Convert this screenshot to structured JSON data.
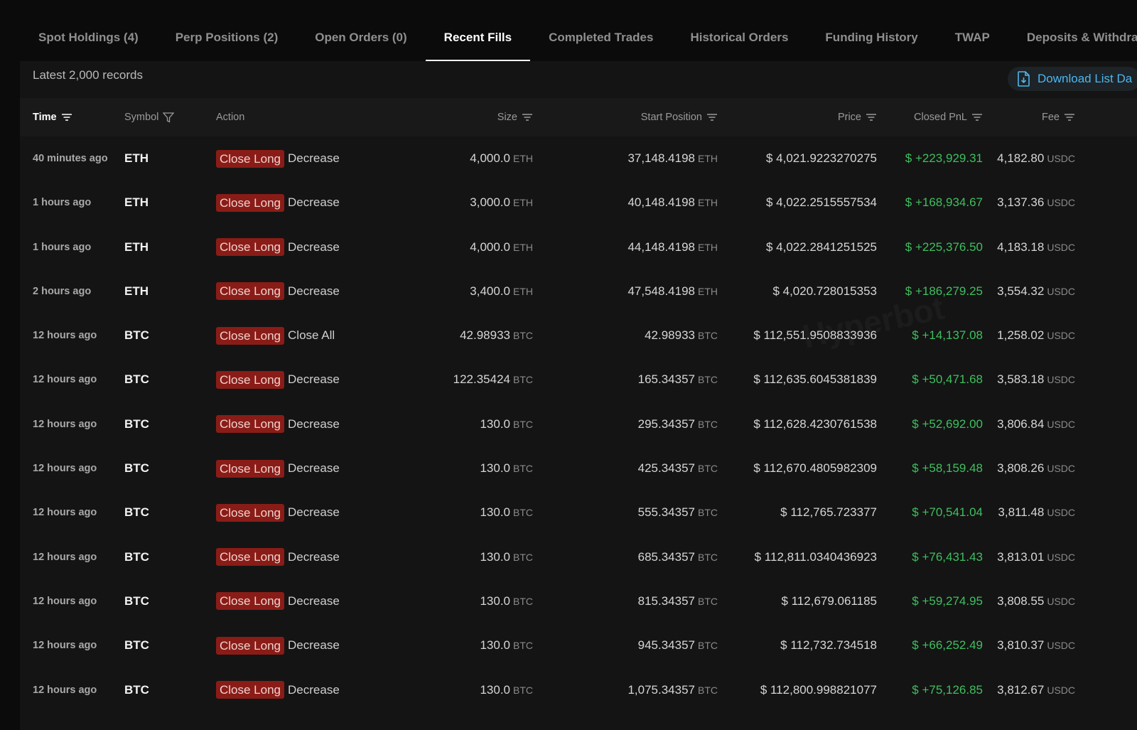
{
  "tabs": [
    {
      "label": "Spot Holdings (4)"
    },
    {
      "label": "Perp Positions (2)"
    },
    {
      "label": "Open Orders (0)"
    },
    {
      "label": "Recent Fills",
      "active": true
    },
    {
      "label": "Completed Trades"
    },
    {
      "label": "Historical Orders"
    },
    {
      "label": "Funding History"
    },
    {
      "label": "TWAP"
    },
    {
      "label": "Deposits & Withdraw"
    }
  ],
  "records_label": "Latest 2,000 records",
  "download_label": "Download List Da",
  "watermark": "Hyperbot",
  "columns": {
    "time": "Time",
    "symbol": "Symbol",
    "action": "Action",
    "size": "Size",
    "start_position": "Start Position",
    "price": "Price",
    "closed_pnl": "Closed PnL",
    "fee": "Fee"
  },
  "colors": {
    "accent": "#4fb6ef",
    "pnl_positive": "#3fbf5f",
    "badge_bg": "#8a1c17"
  },
  "rows": [
    {
      "time": "40 minutes ago",
      "symbol": "ETH",
      "badge": "Close Long",
      "action": "Decrease",
      "size": "4,000.0",
      "size_unit": "ETH",
      "start": "37,148.4198",
      "start_unit": "ETH",
      "price": "$ 4,021.9223270275",
      "pnl": "$ +223,929.31",
      "fee": "4,182.80",
      "fee_unit": "USDC"
    },
    {
      "time": "1 hours ago",
      "symbol": "ETH",
      "badge": "Close Long",
      "action": "Decrease",
      "size": "3,000.0",
      "size_unit": "ETH",
      "start": "40,148.4198",
      "start_unit": "ETH",
      "price": "$ 4,022.2515557534",
      "pnl": "$ +168,934.67",
      "fee": "3,137.36",
      "fee_unit": "USDC"
    },
    {
      "time": "1 hours ago",
      "symbol": "ETH",
      "badge": "Close Long",
      "action": "Decrease",
      "size": "4,000.0",
      "size_unit": "ETH",
      "start": "44,148.4198",
      "start_unit": "ETH",
      "price": "$ 4,022.2841251525",
      "pnl": "$ +225,376.50",
      "fee": "4,183.18",
      "fee_unit": "USDC"
    },
    {
      "time": "2 hours ago",
      "symbol": "ETH",
      "badge": "Close Long",
      "action": "Decrease",
      "size": "3,400.0",
      "size_unit": "ETH",
      "start": "47,548.4198",
      "start_unit": "ETH",
      "price": "$ 4,020.728015353",
      "pnl": "$ +186,279.25",
      "fee": "3,554.32",
      "fee_unit": "USDC"
    },
    {
      "time": "12 hours ago",
      "symbol": "BTC",
      "badge": "Close Long",
      "action": "Close All",
      "size": "42.98933",
      "size_unit": "BTC",
      "start": "42.98933",
      "start_unit": "BTC",
      "price": "$ 112,551.9508833936",
      "pnl": "$ +14,137.08",
      "fee": "1,258.02",
      "fee_unit": "USDC"
    },
    {
      "time": "12 hours ago",
      "symbol": "BTC",
      "badge": "Close Long",
      "action": "Decrease",
      "size": "122.35424",
      "size_unit": "BTC",
      "start": "165.34357",
      "start_unit": "BTC",
      "price": "$ 112,635.6045381839",
      "pnl": "$ +50,471.68",
      "fee": "3,583.18",
      "fee_unit": "USDC"
    },
    {
      "time": "12 hours ago",
      "symbol": "BTC",
      "badge": "Close Long",
      "action": "Decrease",
      "size": "130.0",
      "size_unit": "BTC",
      "start": "295.34357",
      "start_unit": "BTC",
      "price": "$ 112,628.4230761538",
      "pnl": "$ +52,692.00",
      "fee": "3,806.84",
      "fee_unit": "USDC"
    },
    {
      "time": "12 hours ago",
      "symbol": "BTC",
      "badge": "Close Long",
      "action": "Decrease",
      "size": "130.0",
      "size_unit": "BTC",
      "start": "425.34357",
      "start_unit": "BTC",
      "price": "$ 112,670.4805982309",
      "pnl": "$ +58,159.48",
      "fee": "3,808.26",
      "fee_unit": "USDC"
    },
    {
      "time": "12 hours ago",
      "symbol": "BTC",
      "badge": "Close Long",
      "action": "Decrease",
      "size": "130.0",
      "size_unit": "BTC",
      "start": "555.34357",
      "start_unit": "BTC",
      "price": "$ 112,765.723377",
      "pnl": "$ +70,541.04",
      "fee": "3,811.48",
      "fee_unit": "USDC"
    },
    {
      "time": "12 hours ago",
      "symbol": "BTC",
      "badge": "Close Long",
      "action": "Decrease",
      "size": "130.0",
      "size_unit": "BTC",
      "start": "685.34357",
      "start_unit": "BTC",
      "price": "$ 112,811.0340436923",
      "pnl": "$ +76,431.43",
      "fee": "3,813.01",
      "fee_unit": "USDC"
    },
    {
      "time": "12 hours ago",
      "symbol": "BTC",
      "badge": "Close Long",
      "action": "Decrease",
      "size": "130.0",
      "size_unit": "BTC",
      "start": "815.34357",
      "start_unit": "BTC",
      "price": "$ 112,679.061185",
      "pnl": "$ +59,274.95",
      "fee": "3,808.55",
      "fee_unit": "USDC"
    },
    {
      "time": "12 hours ago",
      "symbol": "BTC",
      "badge": "Close Long",
      "action": "Decrease",
      "size": "130.0",
      "size_unit": "BTC",
      "start": "945.34357",
      "start_unit": "BTC",
      "price": "$ 112,732.734518",
      "pnl": "$ +66,252.49",
      "fee": "3,810.37",
      "fee_unit": "USDC"
    },
    {
      "time": "12 hours ago",
      "symbol": "BTC",
      "badge": "Close Long",
      "action": "Decrease",
      "size": "130.0",
      "size_unit": "BTC",
      "start": "1,075.34357",
      "start_unit": "BTC",
      "price": "$ 112,800.998821077",
      "pnl": "$ +75,126.85",
      "fee": "3,812.67",
      "fee_unit": "USDC"
    }
  ]
}
